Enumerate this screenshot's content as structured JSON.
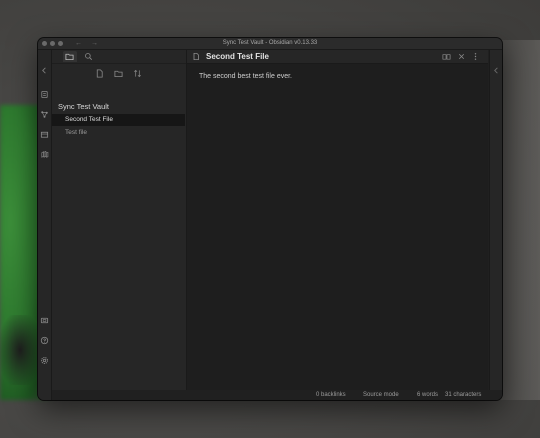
{
  "window": {
    "title": "Sync Test Vault - Obsidian v0.13.33"
  },
  "titlebar": {
    "back_icon": "arrow-left-icon",
    "forward_icon": "arrow-right-icon",
    "back_glyph": "←",
    "forward_glyph": "→"
  },
  "ribbon": {
    "icons": [
      "collapse-left-icon",
      "open-quick-switcher-icon",
      "graph-view-icon",
      "open-canvas-icon",
      "daily-notes-icon",
      "open-vault-icon",
      "help-icon",
      "settings-icon"
    ]
  },
  "file_explorer": {
    "tabs": [
      "folder-icon",
      "search-icon"
    ],
    "actions": [
      "new-note-icon",
      "new-folder-icon",
      "sort-icon"
    ],
    "vault_name": "Sync Test Vault",
    "files": [
      {
        "label": "Second Test File",
        "active": true
      },
      {
        "label": "Test file",
        "active": false
      }
    ]
  },
  "editor": {
    "file_title": "Second Test File",
    "content": "The second best test file ever.",
    "header_actions": [
      "reading-view-icon",
      "close-icon",
      "more-options-icon"
    ]
  },
  "statusbar": {
    "backlinks": "0 backlinks",
    "mode": "Source mode",
    "words": "6 words",
    "characters": "31 characters"
  }
}
